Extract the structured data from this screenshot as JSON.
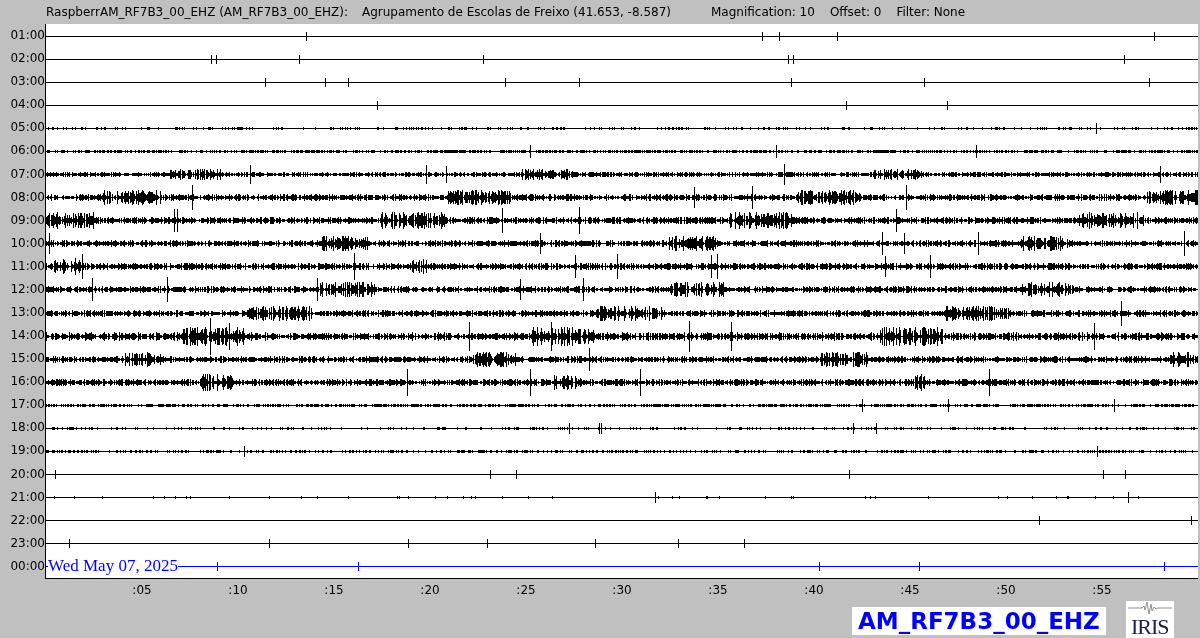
{
  "header": {
    "station": "RaspberrAM_RF7B3_00_EHZ (AM_RF7B3_00_EHZ):",
    "location": "Agrupamento de Escolas de Freixo (41.653, -8.587)",
    "magnification": "Magnification: 10",
    "offset": "Offset: 0",
    "filter": "Filter: None"
  },
  "helicorder": {
    "rows": [
      {
        "time": "01:00",
        "color": "#000000"
      },
      {
        "time": "02:00",
        "color": "#000000"
      },
      {
        "time": "03:00",
        "color": "#000000"
      },
      {
        "time": "04:00",
        "color": "#000000"
      },
      {
        "time": "05:00",
        "color": "#000000"
      },
      {
        "time": "06:00",
        "color": "#000000"
      },
      {
        "time": "07:00",
        "color": "#000000"
      },
      {
        "time": "08:00",
        "color": "#000000"
      },
      {
        "time": "09:00",
        "color": "#000000"
      },
      {
        "time": "10:00",
        "color": "#000000"
      },
      {
        "time": "11:00",
        "color": "#000000"
      },
      {
        "time": "12:00",
        "color": "#000000"
      },
      {
        "time": "13:00",
        "color": "#000000"
      },
      {
        "time": "14:00",
        "color": "#000000"
      },
      {
        "time": "15:00",
        "color": "#000000"
      },
      {
        "time": "16:00",
        "color": "#000000"
      },
      {
        "time": "17:00",
        "color": "#000000"
      },
      {
        "time": "18:00",
        "color": "#000000"
      },
      {
        "time": "19:00",
        "color": "#000000"
      },
      {
        "time": "20:00",
        "color": "#000000"
      },
      {
        "time": "21:00",
        "color": "#000000"
      },
      {
        "time": "22:00",
        "color": "#000000"
      },
      {
        "time": "23:00",
        "color": "#000000"
      },
      {
        "time": "00:00",
        "color": "#0000ff"
      }
    ],
    "date": "Wed May 07, 2025",
    "x_ticks": [
      ":05",
      ":10",
      ":15",
      ":20",
      ":25",
      ":30",
      ":35",
      ":40",
      ":45",
      ":50",
      ":55"
    ]
  },
  "channel_label": "AM_RF7B3_00_EHZ",
  "logo": "IRIS"
}
